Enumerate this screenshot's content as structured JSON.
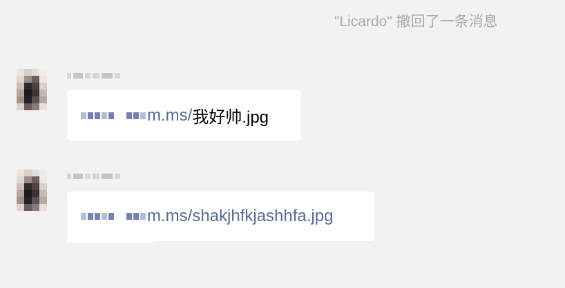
{
  "chat": {
    "recall_notice": "\"Licardo\" 撤回了一条消息",
    "messages": [
      {
        "sender_name": "",
        "link_visible": "m.ms/",
        "filename": "我好帅.jpg"
      },
      {
        "sender_name": "",
        "link_visible": "m.ms/shakjhfkjashhfa.jpg"
      }
    ]
  },
  "colors": {
    "background": "#f2f2f2",
    "bubble": "#ffffff",
    "link": "#576b95",
    "notice_text": "#ababab"
  },
  "icons": {
    "avatar": "user-avatar-pixelated"
  }
}
